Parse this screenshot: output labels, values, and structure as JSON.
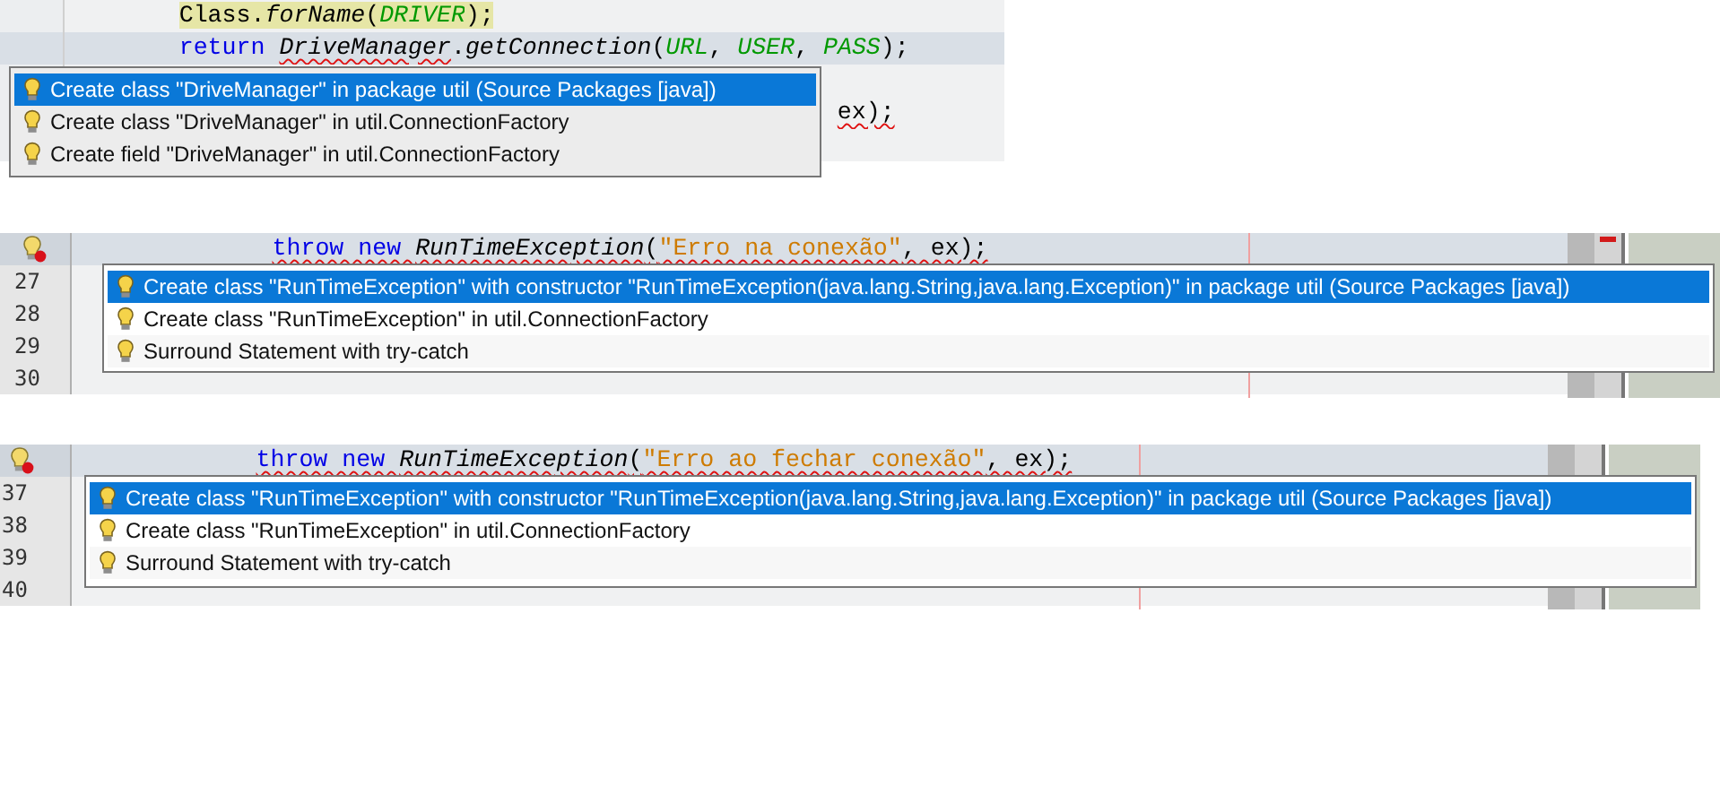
{
  "snippets": [
    {
      "lines": [
        {
          "current": false,
          "segments": [
            {
              "text": "        Class.",
              "kind": "marked-plain",
              "error": false
            },
            {
              "text": "forName",
              "kind": "marked-italic",
              "error": false
            },
            {
              "text": "(",
              "kind": "marked-plain",
              "error": false
            },
            {
              "text": "DRIVER",
              "kind": "marked-constant",
              "error": false
            },
            {
              "text": ");",
              "kind": "marked-plain",
              "error": false
            }
          ]
        },
        {
          "current": true,
          "segments": [
            {
              "text": "        return ",
              "kind": "keyword",
              "error": false
            },
            {
              "text": "DriveManager",
              "kind": "italic",
              "error": true
            },
            {
              "text": ".",
              "kind": "plain",
              "error": false
            },
            {
              "text": "getConnection",
              "kind": "italic",
              "error": false
            },
            {
              "text": "(",
              "kind": "plain",
              "error": false
            },
            {
              "text": "URL",
              "kind": "constant",
              "error": false
            },
            {
              "text": ", ",
              "kind": "plain",
              "error": false
            },
            {
              "text": "USER",
              "kind": "constant",
              "error": false
            },
            {
              "text": ", ",
              "kind": "plain",
              "error": false
            },
            {
              "text": "PASS",
              "kind": "constant",
              "error": false
            },
            {
              "text": ");",
              "kind": "plain",
              "error": false
            }
          ]
        },
        {
          "current": false
        },
        {
          "current": false,
          "segments": [
            {
              "text": "                                                      ex);",
              "kind": "plain",
              "error": true
            }
          ]
        },
        {
          "current": false
        }
      ],
      "popup": {
        "items": [
          {
            "label": "Create class \"DriveManager\" in package util (Source Packages [java])",
            "selected": true
          },
          {
            "label": "Create class \"DriveManager\" in util.ConnectionFactory",
            "selected": false
          },
          {
            "label": "Create field \"DriveManager\" in util.ConnectionFactory",
            "selected": false
          }
        ]
      }
    },
    {
      "lines": [
        {
          "current": true,
          "hint": true,
          "segments": [
            {
              "text": "            throw new ",
              "kind": "keyword",
              "error": true
            },
            {
              "text": "RunTimeException",
              "kind": "italic",
              "error": true
            },
            {
              "text": "(",
              "kind": "plain",
              "error": true
            },
            {
              "text": "\"Erro na conexão\"",
              "kind": "string",
              "error": true
            },
            {
              "text": ", ex);",
              "kind": "plain",
              "error": true
            }
          ]
        },
        {
          "current": false,
          "hint": false,
          "number": "27"
        },
        {
          "current": false,
          "hint": false,
          "number": "28"
        },
        {
          "current": false,
          "hint": false,
          "number": "29"
        },
        {
          "current": false,
          "hint": false,
          "number": "30"
        }
      ],
      "popup": {
        "items": [
          {
            "label": "Create class \"RunTimeException\" with constructor \"RunTimeException(java.lang.String,java.lang.Exception)\" in package util (Source Packages [java])",
            "selected": true
          },
          {
            "label": "Create class \"RunTimeException\" in util.ConnectionFactory",
            "selected": false
          },
          {
            "label": "Surround Statement with try-catch",
            "selected": false
          }
        ]
      }
    },
    {
      "lines": [
        {
          "current": true,
          "hint": true,
          "segments": [
            {
              "text": "            throw new ",
              "kind": "keyword",
              "error": true
            },
            {
              "text": "RunTimeException",
              "kind": "italic",
              "error": true
            },
            {
              "text": "(",
              "kind": "plain",
              "error": true
            },
            {
              "text": "\"Erro ao fechar conexão\"",
              "kind": "string",
              "error": true
            },
            {
              "text": ", ex);",
              "kind": "plain",
              "error": true
            }
          ]
        },
        {
          "current": false,
          "hint": false,
          "number": "37"
        },
        {
          "current": false,
          "hint": false,
          "number": "38"
        },
        {
          "current": false,
          "hint": false,
          "number": "39"
        },
        {
          "current": false,
          "hint": false,
          "number": "40"
        }
      ],
      "popup": {
        "items": [
          {
            "label": "Create class \"RunTimeException\" with constructor \"RunTimeException(java.lang.String,java.lang.Exception)\" in package util (Source Packages [java])",
            "selected": true
          },
          {
            "label": "Create class \"RunTimeException\" in util.ConnectionFactory",
            "selected": false
          },
          {
            "label": "Surround Statement with try-catch",
            "selected": false
          }
        ]
      }
    }
  ]
}
